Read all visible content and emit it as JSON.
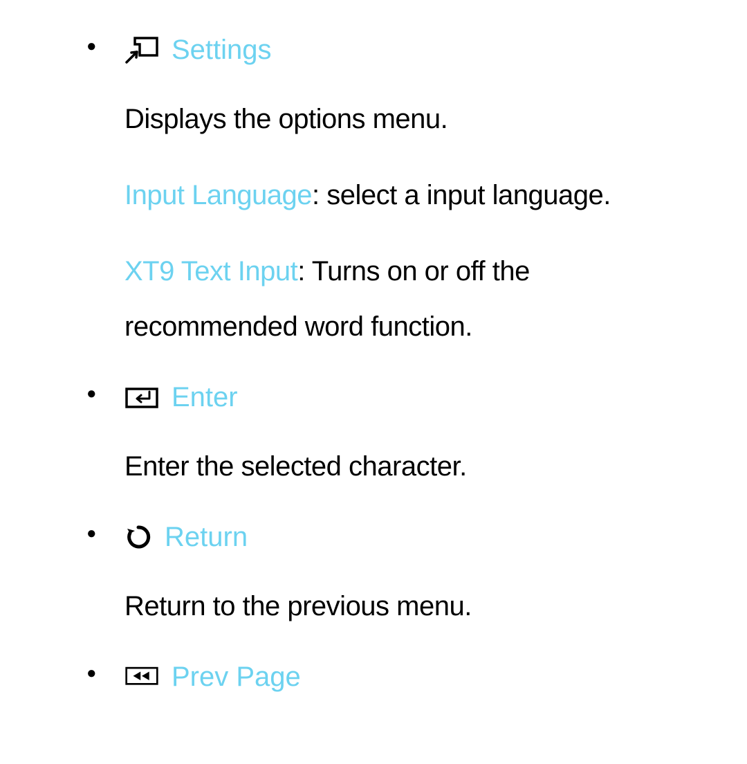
{
  "items": [
    {
      "label": "Settings",
      "desc": "Displays the options menu.",
      "sub": [
        {
          "highlight": "Input Language",
          "text": ": select a input language."
        },
        {
          "highlight": "XT9 Text Input",
          "text": ": Turns on or off the recommended word function."
        }
      ]
    },
    {
      "label": "Enter",
      "desc": "Enter the selected character."
    },
    {
      "label": "Return",
      "desc": "Return to the previous menu."
    },
    {
      "label": "Prev Page"
    }
  ]
}
